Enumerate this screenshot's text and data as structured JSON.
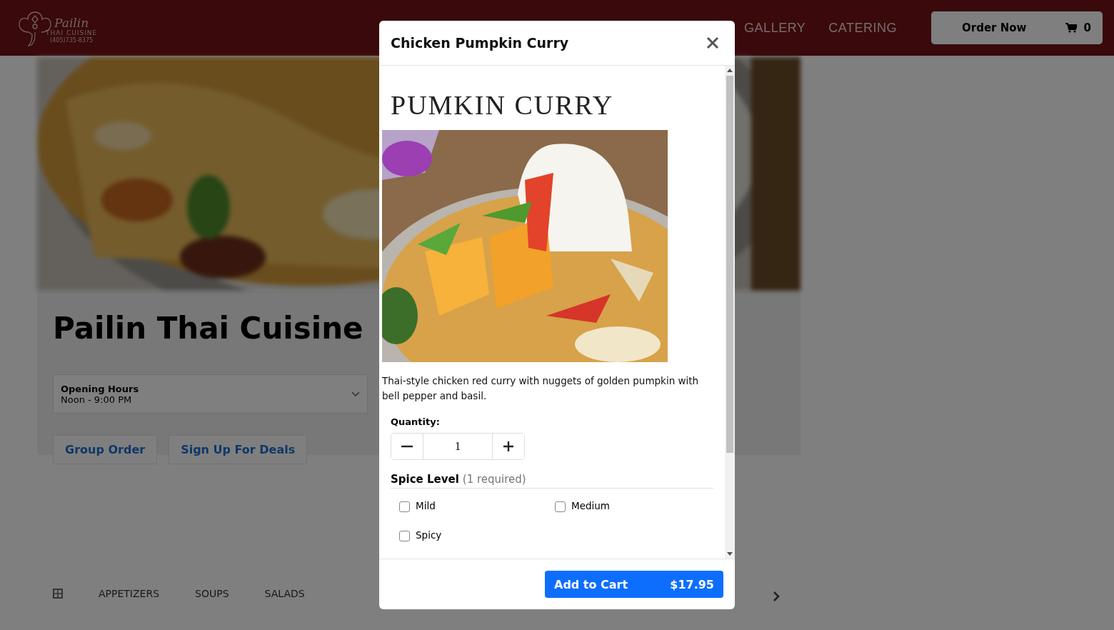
{
  "header": {
    "logo": {
      "script": "Pailin",
      "subtitle": "THAI CUISINE",
      "phone": "(405)735-8375"
    },
    "nav": [
      "GALLERY",
      "CATERING"
    ],
    "order_button": {
      "label": "Order Now",
      "cart_count": "0"
    }
  },
  "restaurant": {
    "name": "Pailin Thai Cuisine",
    "hours": {
      "label": "Opening Hours",
      "value": "Noon - 9:00 PM"
    },
    "actions": [
      "Group Order",
      "Sign Up For Deals"
    ],
    "categories": [
      "APPETIZERS",
      "SOUPS",
      "SALADS"
    ]
  },
  "modal": {
    "title": "Chicken Pumpkin Curry",
    "heading": "PUMKIN CURRY",
    "description": "Thai-style chicken red curry with nuggets of golden pumpkin with bell pepper and basil.",
    "quantity": {
      "label": "Quantity:",
      "value": "1"
    },
    "option_group": {
      "title": "Spice Level",
      "note": "(1 required)",
      "options": [
        {
          "label": "Mild",
          "checked": false
        },
        {
          "label": "Medium",
          "checked": false
        },
        {
          "label": "Spicy",
          "checked": false
        }
      ]
    },
    "add_button": {
      "label": "Add to Cart",
      "price": "$17.95"
    }
  }
}
